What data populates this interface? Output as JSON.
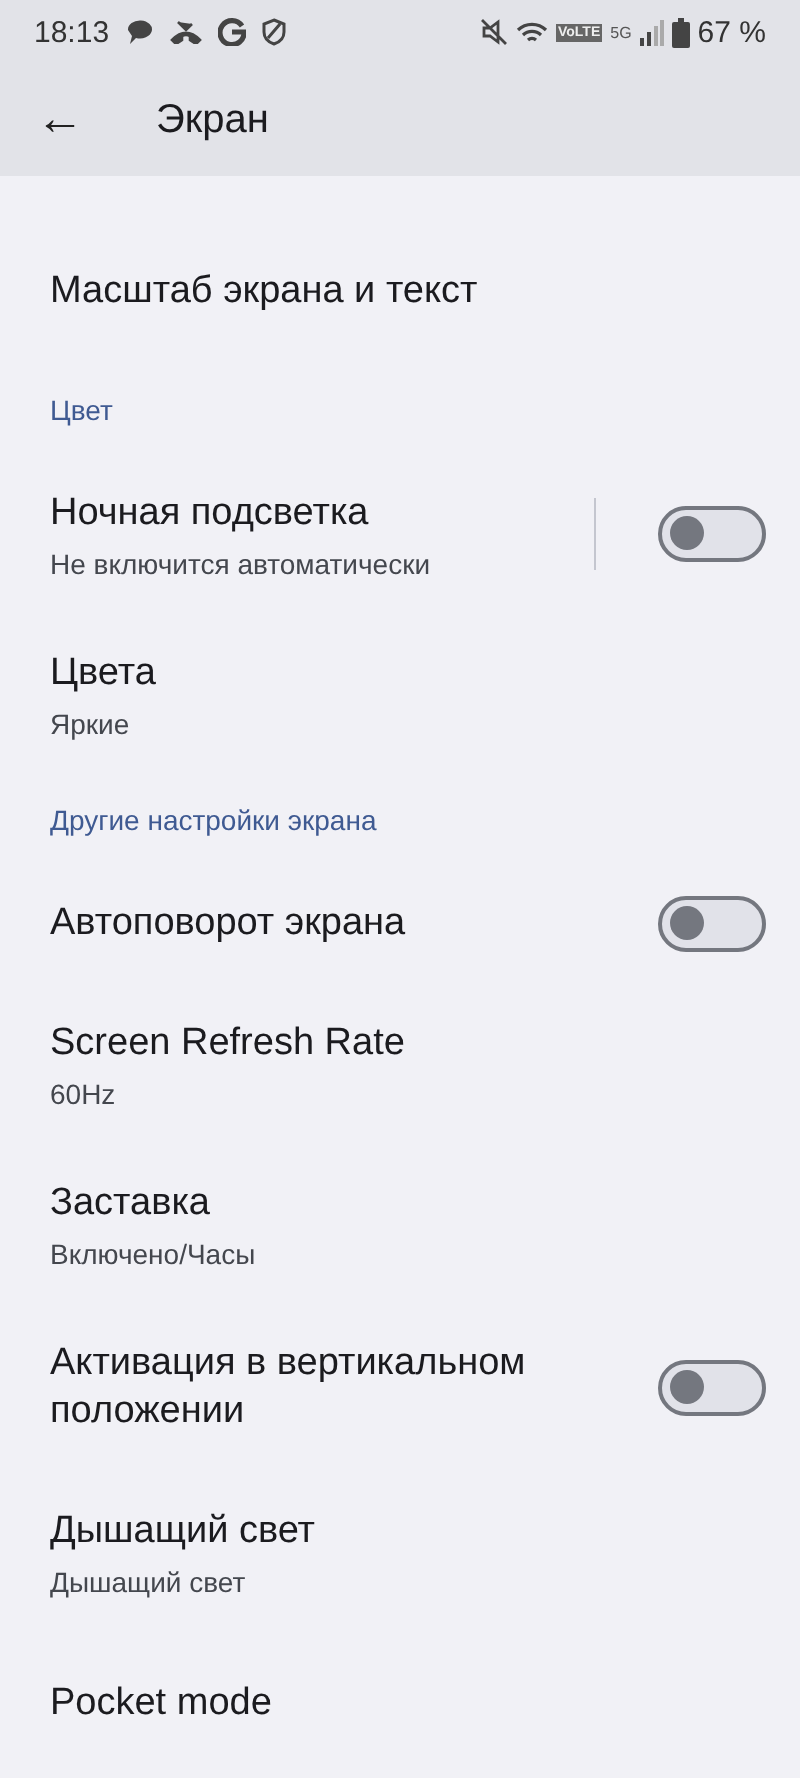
{
  "status_bar": {
    "time": "18:13",
    "network": "VoLTE",
    "generation": "5G",
    "battery": "67 %"
  },
  "app_bar": {
    "back": "←",
    "title": "Экран"
  },
  "items": [
    {
      "kind": "item",
      "title": "Масштаб экрана и текст"
    },
    {
      "kind": "header",
      "title": "Цвет"
    },
    {
      "kind": "toggle",
      "title": "Ночная подсветка",
      "summary": "Не включится автоматически",
      "on": false,
      "divider": true
    },
    {
      "kind": "item",
      "title": "Цвета",
      "summary": "Яркие"
    },
    {
      "kind": "header",
      "title": "Другие настройки экрана"
    },
    {
      "kind": "toggle",
      "title": "Автоповорот экрана",
      "on": false
    },
    {
      "kind": "item",
      "title": "Screen Refresh Rate",
      "summary": "60Hz"
    },
    {
      "kind": "item",
      "title": "Заставка",
      "summary": "Включено/Часы"
    },
    {
      "kind": "toggle",
      "title": "Активация в вертикальном положении",
      "on": false
    },
    {
      "kind": "item",
      "title": "Дышащий свет",
      "summary": "Дышащий свет"
    },
    {
      "kind": "item",
      "title": "Pocket mode"
    }
  ]
}
